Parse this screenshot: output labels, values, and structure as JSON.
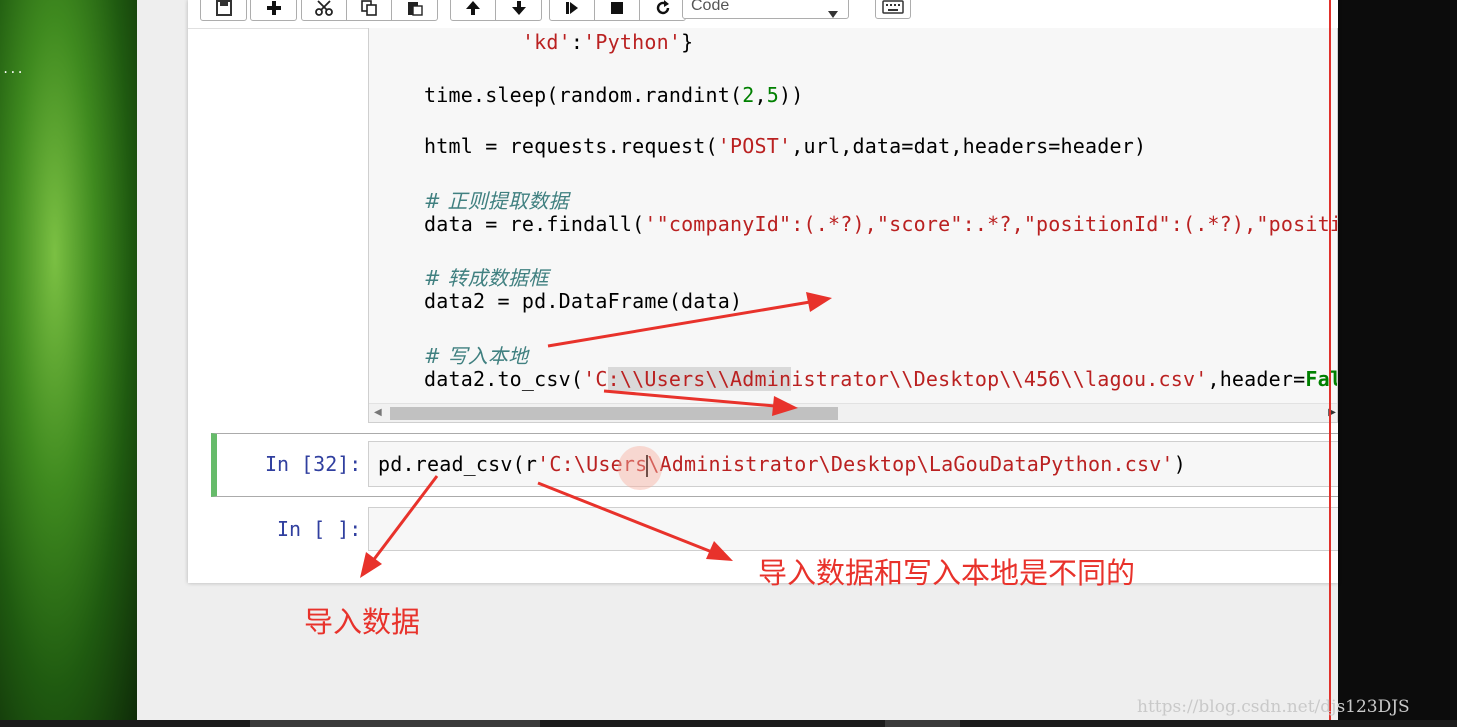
{
  "desktop": {
    "left_ellipsis": "..."
  },
  "toolbar": {
    "buttons": [
      "save-icon",
      "plus-icon",
      "scissors-icon",
      "copy-icon",
      "paste-icon",
      "arrow-up-icon",
      "arrow-down-icon",
      "step-icon",
      "stop-icon",
      "restart-icon"
    ],
    "cell_type": "Code"
  },
  "code_cell": {
    "lines": [
      {
        "pre": "        ",
        "s1": "'kd'",
        "m1": ":",
        "s2": "'Python'",
        "post": "}"
      },
      {
        "a": "time.sleep(random.randint(",
        "n1": "2",
        "b": ",",
        "n2": "5",
        "c": "))"
      },
      {
        "a": "html = requests.request(",
        "s": "'POST'",
        "b": ",url,data=dat,headers=header)"
      },
      {
        "comment": "# 正则提取数据"
      },
      {
        "a": "data = re.findall(",
        "s": "'\"companyId\":(.*?),\"score\":.*?,\"positionId\":(.*?),\"position"
      },
      {
        "comment": "# 转成数据框"
      },
      {
        "a": "data2 = pd.DataFrame(data)"
      },
      {
        "comment": "# 写入本地"
      },
      {
        "a": "data2.to_csv(",
        "s1": "'C",
        "hl": ":\\\\Users\\\\Admin",
        "s2": "istrator\\\\Desktop\\\\456\\\\lagou.csv'",
        "b": ",header=",
        "k": "False"
      }
    ]
  },
  "cell_32": {
    "prompt": "In [32]:",
    "code_a": "pd.read_csv(r",
    "code_s1": "'C:\\Users",
    "code_s2": "\\Administrator\\Desktop\\LaGouDataPython.csv'",
    "code_end": ")"
  },
  "cell_empty": {
    "prompt": "In [ ]:"
  },
  "annotations": {
    "import_data": "导入数据",
    "different": "导入数据和写入本地是不同的"
  },
  "watermark": "https://blog.csdn.net/djs123DJS",
  "colors": {
    "annotation": "#e8322b",
    "selected_cell": "#66bb6a",
    "prompt": "#303f9f",
    "string": "#ba2121",
    "number": "#008000"
  }
}
